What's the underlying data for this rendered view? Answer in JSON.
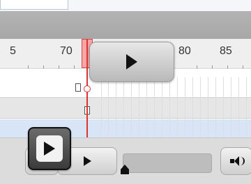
{
  "ruler": {
    "labels": [
      "5",
      "70",
      "80",
      "85"
    ]
  },
  "timeline": {
    "current_frame": 72
  },
  "controls": {
    "seek_position_percent": 0,
    "sound_state": "on"
  }
}
